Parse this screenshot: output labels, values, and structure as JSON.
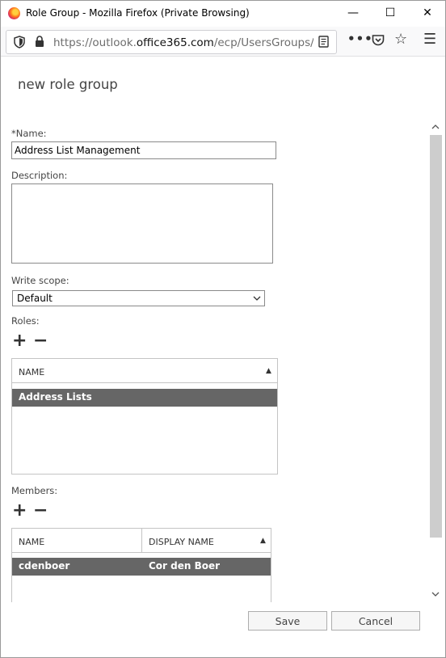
{
  "window": {
    "title": "Role Group - Mozilla Firefox (Private Browsing)",
    "minimize": "—",
    "maximize": "☐",
    "close": "✕"
  },
  "navbar": {
    "url_prefix": "https://outlook.",
    "url_domain": "office365.com",
    "url_suffix": "/ecp/UsersGroups/New"
  },
  "page": {
    "title": "new role group"
  },
  "form": {
    "name_label": "*Name:",
    "name_value": "Address List Management",
    "description_label": "Description:",
    "description_value": "",
    "write_scope_label": "Write scope:",
    "write_scope_value": "Default",
    "roles_label": "Roles:",
    "members_label": "Members:",
    "add_symbol": "+",
    "remove_symbol": "−"
  },
  "roles_grid": {
    "columns": [
      "NAME"
    ],
    "rows": [
      {
        "name": "Address Lists"
      }
    ]
  },
  "members_grid": {
    "columns": [
      "NAME",
      "DISPLAY NAME"
    ],
    "rows": [
      {
        "name": "cdenboer",
        "display_name": "Cor den Boer"
      }
    ]
  },
  "footer": {
    "save_label": "Save",
    "cancel_label": "Cancel"
  }
}
